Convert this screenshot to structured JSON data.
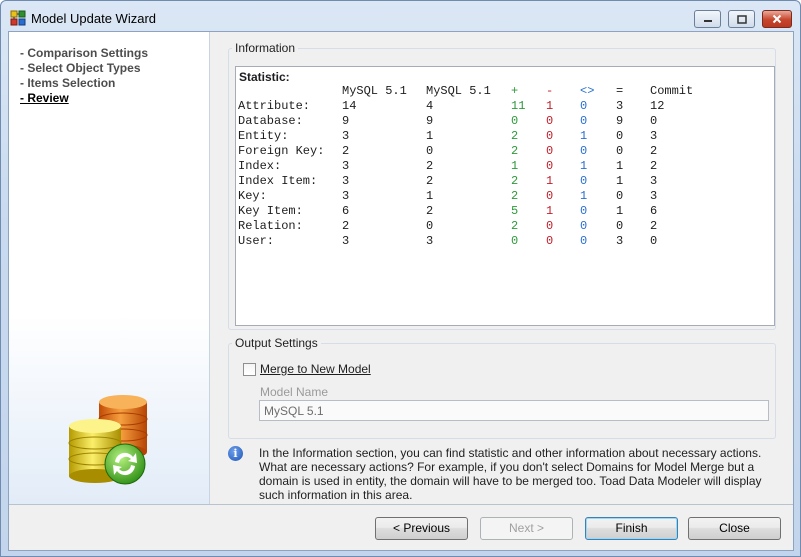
{
  "window": {
    "title": "Model Update Wizard"
  },
  "nav": {
    "items": [
      {
        "label": "- Comparison Settings",
        "active": false
      },
      {
        "label": "- Select Object Types",
        "active": false
      },
      {
        "label": "- Items Selection",
        "active": false
      },
      {
        "label": "- Review",
        "active": true
      }
    ]
  },
  "information": {
    "group_label": "Information",
    "heading": "Statistic:",
    "columns": [
      "MySQL 5.1",
      "MySQL 5.1",
      "+",
      "-",
      "<>",
      "=",
      "Commit"
    ],
    "rows": [
      {
        "name": "Attribute:",
        "values": [
          "14",
          "4",
          "11",
          "1",
          "0",
          "3",
          "12"
        ]
      },
      {
        "name": "Database:",
        "values": [
          "9",
          "9",
          "0",
          "0",
          "0",
          "9",
          "0"
        ]
      },
      {
        "name": "Entity:",
        "values": [
          "3",
          "1",
          "2",
          "0",
          "1",
          "0",
          "3"
        ]
      },
      {
        "name": "Foreign Key:",
        "values": [
          "2",
          "0",
          "2",
          "0",
          "0",
          "0",
          "2"
        ]
      },
      {
        "name": "Index:",
        "values": [
          "3",
          "2",
          "1",
          "0",
          "1",
          "1",
          "2"
        ]
      },
      {
        "name": "Index Item:",
        "values": [
          "3",
          "2",
          "2",
          "1",
          "0",
          "1",
          "3"
        ]
      },
      {
        "name": "Key:",
        "values": [
          "3",
          "1",
          "2",
          "0",
          "1",
          "0",
          "3"
        ]
      },
      {
        "name": "Key Item:",
        "values": [
          "6",
          "2",
          "5",
          "1",
          "0",
          "1",
          "6"
        ]
      },
      {
        "name": "Relation:",
        "values": [
          "2",
          "0",
          "2",
          "0",
          "0",
          "0",
          "2"
        ]
      },
      {
        "name": "User:",
        "values": [
          "3",
          "3",
          "0",
          "0",
          "0",
          "3",
          "0"
        ]
      }
    ]
  },
  "output": {
    "group_label": "Output Settings",
    "merge_label": "Merge to New Model",
    "merge_checked": false,
    "model_name_label": "Model Name",
    "model_name_value": "MySQL 5.1"
  },
  "info_note": "In the Information section, you can find statistic and other information about necessary actions. What are necessary actions? For example, if you don't select Domains for Model Merge but a domain is used in entity, the domain will have to be merged too. Toad Data Modeler will display such information in this area.",
  "buttons": {
    "previous": "< Previous",
    "next": "Next >",
    "finish": "Finish",
    "close": "Close"
  },
  "icons": {
    "title_icon": "model-wizard-icon",
    "side_image": "database-sync-icon",
    "info": "info-icon"
  },
  "colors": {
    "plus": "#2e9a3a",
    "minus": "#c0202c",
    "diff": "#2a6fd0"
  }
}
